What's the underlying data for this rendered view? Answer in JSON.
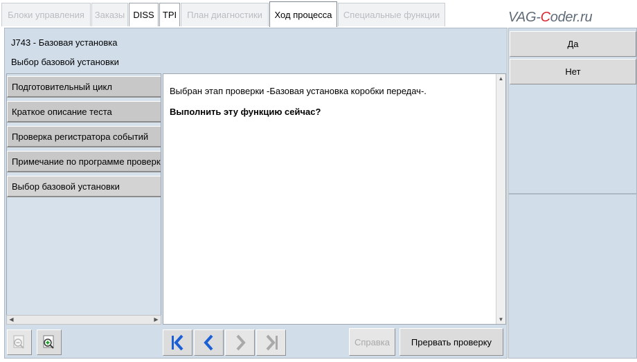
{
  "tabs": [
    {
      "label": "Блоки управления",
      "state": "disabled"
    },
    {
      "label": "Заказы",
      "state": "disabled"
    },
    {
      "label": "DISS",
      "state": "enabled"
    },
    {
      "label": "TPI",
      "state": "enabled"
    },
    {
      "label": "План диагностики",
      "state": "disabled"
    },
    {
      "label": "Ход процесса",
      "state": "active"
    },
    {
      "label": "Специальные функции",
      "state": "disabled"
    }
  ],
  "watermark": {
    "prefix": "VAG-",
    "accent": "C",
    "suffix": "oder.ru"
  },
  "header": {
    "line1": "J743 - Базовая установка",
    "line2": "Выбор базовой установки"
  },
  "nav": {
    "items": [
      {
        "label": "Подготовительный цикл"
      },
      {
        "label": "Краткое описание теста"
      },
      {
        "label": "Проверка регистратора событий"
      },
      {
        "label": "Примечание по программе проверки"
      },
      {
        "label": "Выбор базовой установки"
      }
    ],
    "selected_index": 4
  },
  "content": {
    "line1": "Выбран этап проверки -Базовая установка коробки передач-.",
    "line2": "Выполнить эту функцию сейчас?"
  },
  "toolbar": {
    "zoom_out_icon": "zoom-out-icon",
    "zoom_in_icon": "zoom-in-icon",
    "first_icon": "first-page-icon",
    "prev_icon": "previous-icon",
    "next_icon": "next-icon",
    "last_icon": "last-page-icon",
    "help_label": "Справка",
    "abort_label": "Прервать проверку"
  },
  "right": {
    "yes_label": "Да",
    "no_label": "Нет"
  },
  "colors": {
    "panel": "#d1deea",
    "nav_blue": "#1a5fd6",
    "accent_red": "#d9262e"
  }
}
